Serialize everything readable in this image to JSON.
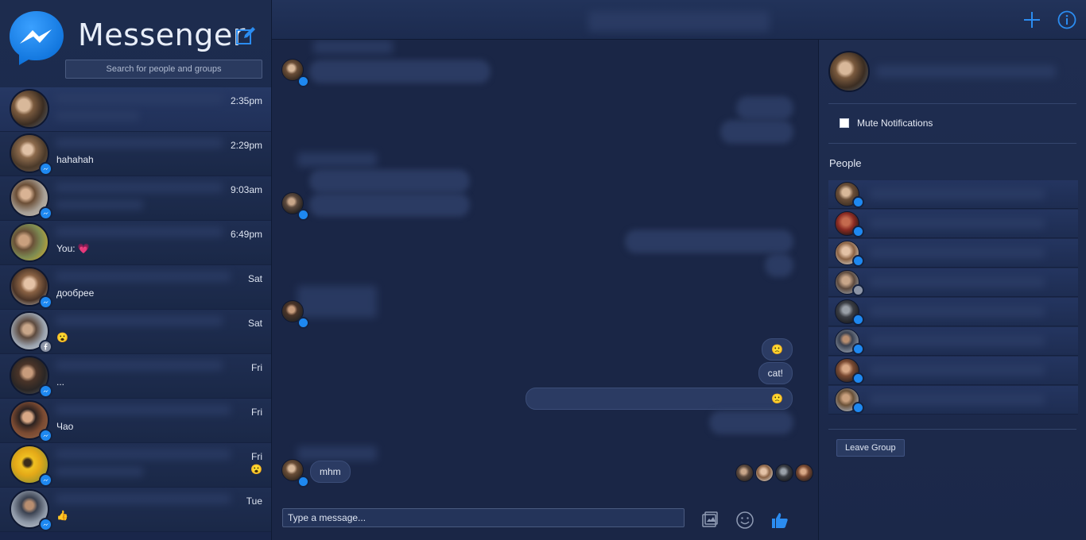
{
  "app": {
    "title": "Messenger",
    "search_placeholder": "Search for people and groups",
    "accent": "#1e88f0"
  },
  "conversations": [
    {
      "time": "2:35pm",
      "snippet": "",
      "badge": "none"
    },
    {
      "time": "2:29pm",
      "snippet": "hahahah",
      "badge": "messenger"
    },
    {
      "time": "9:03am",
      "snippet": "",
      "badge": "messenger"
    },
    {
      "time": "6:49pm",
      "snippet": "You: 💗",
      "badge": "none"
    },
    {
      "time": "Sat",
      "snippet": "дообрее",
      "badge": "messenger"
    },
    {
      "time": "Sat",
      "snippet": "😮",
      "badge": "facebook"
    },
    {
      "time": "Fri",
      "snippet": "...",
      "badge": "messenger"
    },
    {
      "time": "Fri",
      "snippet": "Чао",
      "badge": "messenger"
    },
    {
      "time": "Fri",
      "snippet": "",
      "emoji": "😮",
      "badge": "messenger"
    },
    {
      "time": "Tue",
      "snippet": "👍",
      "badge": "messenger"
    }
  ],
  "chat": {
    "messages": {
      "sent_emoji": "🙁",
      "sent_cat": "cat!",
      "sent_long_emoji": "🙁",
      "received_last": "mhm"
    },
    "composer_placeholder": "Type a message..."
  },
  "panel": {
    "mute_label": "Mute Notifications",
    "people_title": "People",
    "people_count": 8,
    "leave_label": "Leave Group"
  }
}
